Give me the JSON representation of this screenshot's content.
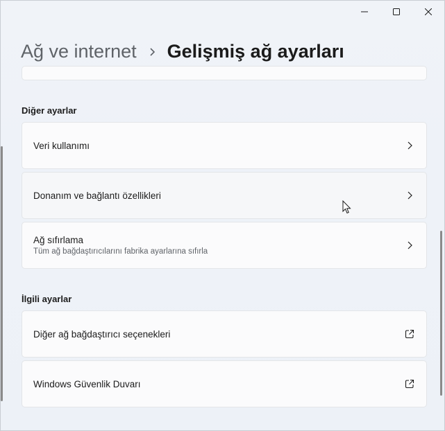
{
  "window": {
    "minimize_icon": "minimize-icon",
    "maximize_icon": "maximize-icon",
    "close_icon": "close-icon"
  },
  "header": {
    "parent": "Ağ ve internet",
    "separator_icon": "chevron-right-icon",
    "current": "Gelişmiş ağ ayarları"
  },
  "sections": {
    "other": {
      "title": "Diğer ayarlar",
      "items": [
        {
          "label": "Veri kullanımı",
          "icon": "chevron-right-icon"
        },
        {
          "label": "Donanım ve bağlantı özellikleri",
          "icon": "chevron-right-icon"
        },
        {
          "label": "Ağ sıfırlama",
          "sublabel": "Tüm ağ bağdaştırıcılarını fabrika ayarlarına sıfırla",
          "icon": "chevron-right-icon"
        }
      ]
    },
    "related": {
      "title": "İlgili ayarlar",
      "items": [
        {
          "label": "Diğer ağ bağdaştırıcı seçenekleri",
          "icon": "open-external-icon"
        },
        {
          "label": "Windows Güvenlik Duvarı",
          "icon": "open-external-icon"
        }
      ]
    }
  },
  "colors": {
    "background": "#eef2f7",
    "card": "#fbfbfc",
    "text": "#1b1b1b",
    "secondary_text": "#5f6368"
  }
}
